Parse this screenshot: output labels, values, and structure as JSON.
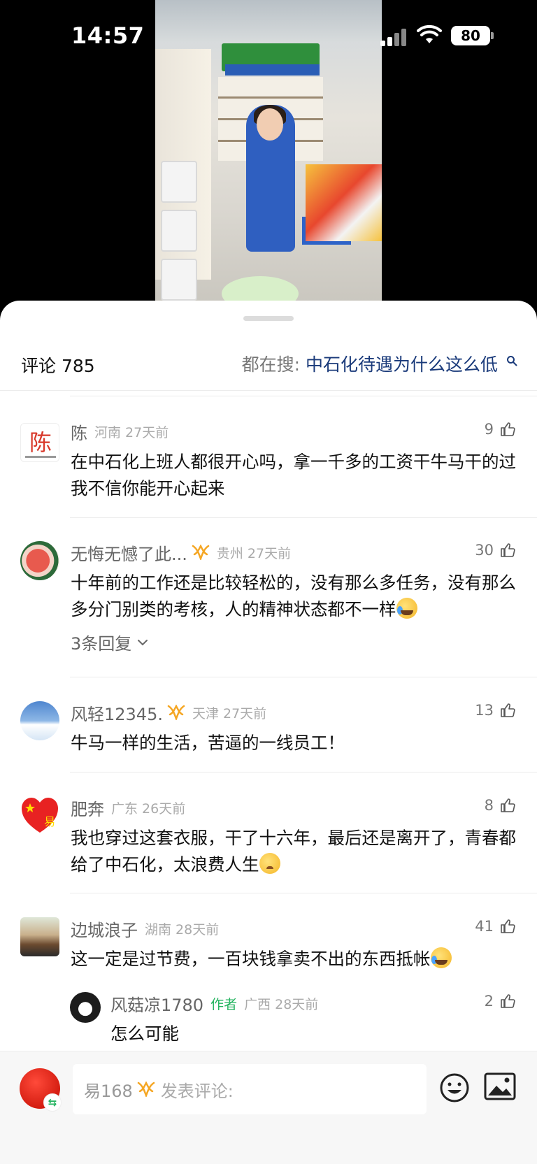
{
  "status_bar": {
    "time": "14:57",
    "battery": "80"
  },
  "sheet": {
    "title": "评论 785",
    "search_label": "都在搜:",
    "search_query": "中石化待遇为什么这么低"
  },
  "comments": [
    {
      "name": "陈",
      "avatar_text": "陈",
      "location": "河南",
      "time": "27天前",
      "likes": "9",
      "text": "在中石化上班人都很开心吗，拿一千多的工资干牛马干的过我不信你能开心起来"
    },
    {
      "name": "无悔无憾了此...",
      "location": "贵州",
      "time": "27天前",
      "likes": "30",
      "text": "十年前的工作还是比较轻松的，没有那么多任务，没有那么多分门别类的考核，人的精神状态都不一样",
      "replies": "3条回复"
    },
    {
      "name": "风轻12345.",
      "location": "天津",
      "time": "27天前",
      "likes": "13",
      "text": "牛马一样的生活，苦逼的一线员工！"
    },
    {
      "name": "肥奔",
      "location": "广东",
      "time": "26天前",
      "likes": "8",
      "text": "我也穿过这套衣服，干了十六年，最后还是离开了，青春都给了中石化，太浪费人生"
    },
    {
      "name": "边城浪子",
      "location": "湖南",
      "time": "28天前",
      "likes": "41",
      "text": "这一定是过节费，一百块钱拿卖不出的东西抵帐"
    }
  ],
  "reply": {
    "name": "风菇凉1780",
    "author_tag": "作者",
    "location": "广西",
    "time": "28天前",
    "likes": "2",
    "text": "怎么可能"
  },
  "bottom_bar": {
    "me_name": "易168",
    "placeholder": "发表评论:"
  },
  "icons": {
    "search": "search-icon",
    "like": "thumbs-up-icon",
    "badge": "vip-badge-icon",
    "chevron": "chevron-down-icon",
    "emoji": "smiley-icon",
    "image": "image-icon"
  },
  "colors": {
    "search_query": "#1a3a7a",
    "author_tag": "#22b35e",
    "badge": "#f5a623"
  }
}
